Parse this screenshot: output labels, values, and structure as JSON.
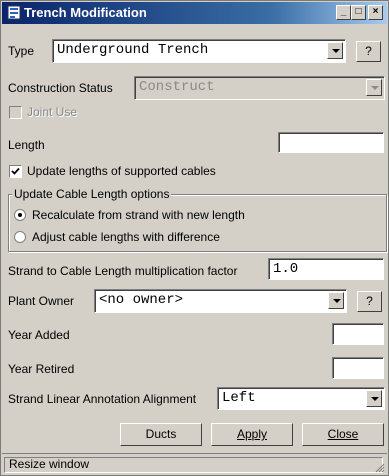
{
  "window": {
    "title": "Trench Modification",
    "minimize_label": "_",
    "maximize_label": "□",
    "close_label": "×"
  },
  "form": {
    "type_label": "Type",
    "type_value": "Underground Trench",
    "type_help": "?",
    "construction_status_label": "Construction Status",
    "construction_status_value": "Construct",
    "joint_use_label": "Joint Use",
    "length_label": "Length",
    "length_value": "",
    "update_lengths_label": "Update lengths of supported cables",
    "update_lengths_checked": true,
    "group_title": "Update Cable Length options",
    "radio_recalculate_label": "Recalculate from strand with new length",
    "radio_adjust_label": "Adjust cable lengths with difference",
    "multiplication_label": "Strand to Cable Length multiplication factor",
    "multiplication_value": "1.0",
    "plant_owner_label": "Plant Owner",
    "plant_owner_value": "<no owner>",
    "plant_owner_help": "?",
    "year_added_label": "Year Added",
    "year_added_value": "",
    "year_retired_label": "Year Retired",
    "year_retired_value": "",
    "alignment_label": "Strand Linear Annotation Alignment",
    "alignment_value": "Left"
  },
  "buttons": {
    "ducts": "Ducts",
    "apply": "Apply",
    "close": "Close"
  },
  "status": {
    "text": "Resize window"
  }
}
